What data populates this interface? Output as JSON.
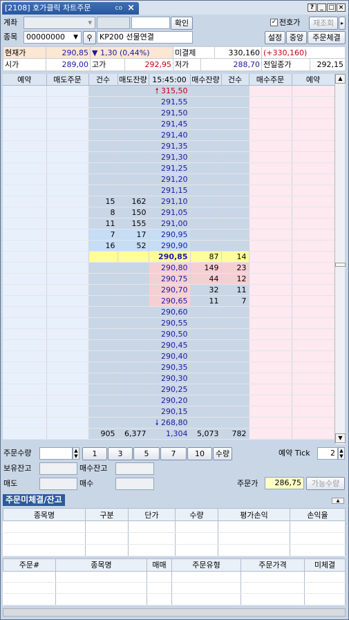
{
  "window": {
    "title": "[2108] 호가클릭 차트주문",
    "link_label": "co",
    "help": "?",
    "minimize": "_",
    "maximize": "□",
    "close": "×"
  },
  "account": {
    "label": "계좌",
    "confirm_btn": "확인",
    "preferred_label": "전호가",
    "refresh_btn": "재조회",
    "more": "▸"
  },
  "symbol": {
    "label": "종목",
    "code": "00000000",
    "name": "KP200 선물연결",
    "settings_btn": "설정",
    "center_btn": "중앙",
    "order_fill_btn": "주문체결"
  },
  "quote": {
    "current_label": "현재가",
    "current": "290,85",
    "change": "1,30 (0,44%)",
    "open_int_label": "미결제",
    "open_int": "330,160",
    "open_int_change": "(+330,160)",
    "open_label": "시가",
    "open": "289,00",
    "high_label": "고가",
    "high": "292,95",
    "low_label": "저가",
    "low": "288,70",
    "prev_close_label": "전일종가",
    "prev_close": "292,15"
  },
  "book": {
    "headers": [
      "예약",
      "매도주문",
      "건수",
      "매도잔량",
      "15:45:00",
      "매수잔량",
      "건수",
      "매수주문",
      "예약"
    ],
    "top_price": "315,50",
    "asks": [
      [
        "",
        "",
        "291,55"
      ],
      [
        "",
        "",
        "291,50"
      ],
      [
        "",
        "",
        "291,45"
      ],
      [
        "",
        "",
        "291,40"
      ],
      [
        "",
        "",
        "291,35"
      ],
      [
        "",
        "",
        "291,30"
      ],
      [
        "",
        "",
        "291,25"
      ],
      [
        "",
        "",
        "291,20"
      ],
      [
        "",
        "",
        "291,15"
      ],
      [
        "15",
        "162",
        "291,10"
      ],
      [
        "8",
        "150",
        "291,05"
      ],
      [
        "11",
        "155",
        "291,00"
      ],
      [
        "7",
        "17",
        "290,95"
      ],
      [
        "16",
        "52",
        "290,90"
      ]
    ],
    "current": {
      "price": "290,85",
      "bid_qty": "87",
      "bid_cnt": "14"
    },
    "bids": [
      [
        "290,80",
        "149",
        "23"
      ],
      [
        "290,75",
        "44",
        "12"
      ],
      [
        "290,70",
        "32",
        "11"
      ],
      [
        "290,65",
        "11",
        "7"
      ],
      [
        "290,60",
        "",
        ""
      ],
      [
        "290,55",
        "",
        ""
      ],
      [
        "290,50",
        "",
        ""
      ],
      [
        "290,45",
        "",
        ""
      ],
      [
        "290,40",
        "",
        ""
      ],
      [
        "290,35",
        "",
        ""
      ],
      [
        "290,30",
        "",
        ""
      ],
      [
        "290,25",
        "",
        ""
      ],
      [
        "290,20",
        "",
        ""
      ],
      [
        "290,15",
        "",
        ""
      ]
    ],
    "bottom_price": "268,80",
    "totals": {
      "ask_cnt": "905",
      "ask_qty": "6,377",
      "diff": "1,304",
      "bid_qty": "5,073",
      "bid_cnt": "782"
    }
  },
  "order": {
    "qty_label": "주문수량",
    "qty_buttons": [
      "1",
      "3",
      "5",
      "7",
      "10"
    ],
    "qty_btn": "수량",
    "reserve_tick_label": "예약 Tick",
    "reserve_tick": "2",
    "hold_label": "보유잔고",
    "buy_hold_label": "매수잔고",
    "sell_label": "매도",
    "buy_label": "매수",
    "price_label": "주문가",
    "price": "286,75",
    "avail_btn": "가능수량"
  },
  "positions": {
    "tab": "주문미체결/잔고",
    "headers": [
      "종목명",
      "구분",
      "단가",
      "수량",
      "평가손익",
      "손익율"
    ]
  },
  "orders": {
    "headers": [
      "주문#",
      "종목명",
      "매매",
      "주문유형",
      "주문가격",
      "미체결"
    ]
  }
}
